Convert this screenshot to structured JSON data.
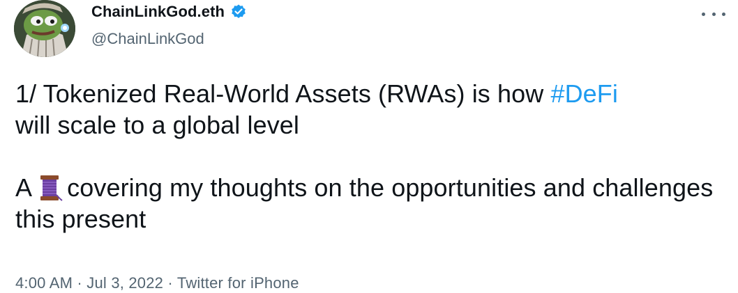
{
  "author": {
    "display_name": "ChainLinkGod.eth",
    "handle": "@ChainLinkGod",
    "verified_icon": "verified-badge-icon",
    "avatar_icon": "pepe-avatar"
  },
  "menu": {
    "more_icon": "more-options-icon"
  },
  "tweet": {
    "line1_prefix": "1/ Tokenized Real-World Assets (RWAs) is how ",
    "hashtag": "#DeFi",
    "line1_suffix": "will scale to a global level",
    "line2_prefix": "A",
    "thread_emoji": "spool-of-thread-emoji",
    "line2_suffix": "covering my thoughts on the opportunities and challenges this present"
  },
  "meta": {
    "time": "4:00 AM",
    "separator1": " · ",
    "date": "Jul 3, 2022",
    "separator2": " · ",
    "source": "Twitter for iPhone"
  },
  "colors": {
    "link": "#1d9bf0",
    "secondary_text": "#536471",
    "primary_text": "#0f1419",
    "verified": "#1d9bf0"
  }
}
